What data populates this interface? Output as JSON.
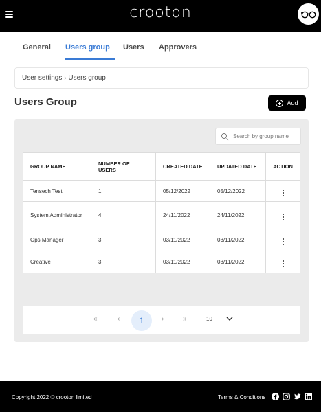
{
  "header": {
    "logo_text": "crooton",
    "menu_icon": "hamburger-menu-icon",
    "avatar_icon": "glasses-icon"
  },
  "tabs": [
    {
      "label": "General",
      "active": false
    },
    {
      "label": "Users group",
      "active": true
    },
    {
      "label": "Users",
      "active": false
    },
    {
      "label": "Approvers",
      "active": false
    }
  ],
  "breadcrumb": {
    "parent": "User settings",
    "current": "Users group"
  },
  "page": {
    "title": "Users Group",
    "add_label": "Add"
  },
  "search": {
    "placeholder": "Search by group name",
    "value": ""
  },
  "table": {
    "headers": {
      "group_name": "GROUP NAME",
      "number_of_users": "NUMBER OF USERS",
      "created_date": "CREATED DATE",
      "updated_date": "UPDATED DATE",
      "action": "ACTION"
    },
    "rows": [
      {
        "group_name": "Tensech Test",
        "number_of_users": "1",
        "created_date": "05/12/2022",
        "updated_date": "05/12/2022"
      },
      {
        "group_name": "System Administrator",
        "number_of_users": "4",
        "created_date": "24/11/2022",
        "updated_date": "24/11/2022"
      },
      {
        "group_name": "Ops Manager",
        "number_of_users": "3",
        "created_date": "03/11/2022",
        "updated_date": "03/11/2022"
      },
      {
        "group_name": "Creative",
        "number_of_users": "3",
        "created_date": "03/11/2022",
        "updated_date": "03/11/2022"
      }
    ]
  },
  "pagination": {
    "first": "«",
    "prev": "‹",
    "current_page": "1",
    "next": "›",
    "last": "»",
    "page_size": "10"
  },
  "footer": {
    "copyright": "Copyright 2022 © crooton limited",
    "terms": "Terms & Conditions",
    "social": [
      "facebook-icon",
      "instagram-icon",
      "twitter-icon",
      "linkedin-icon"
    ]
  },
  "colors": {
    "accent": "#3a7bd5",
    "topbar": "#000000",
    "panel": "#ebebeb"
  }
}
